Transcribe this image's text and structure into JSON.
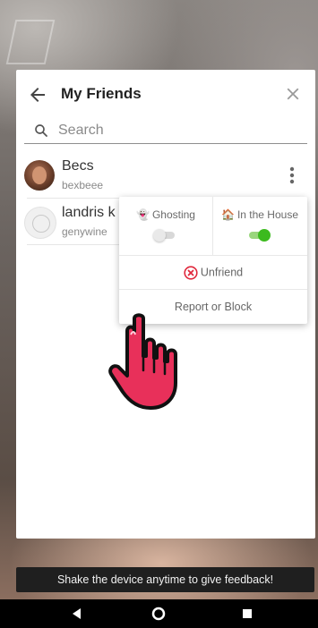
{
  "header": {
    "title": "My Friends",
    "back_icon": "arrow-left-icon",
    "close_icon": "close-icon"
  },
  "search": {
    "placeholder": "Search",
    "value": "",
    "icon": "search-icon"
  },
  "friends": [
    {
      "name": "Becs",
      "username": "bexbeee",
      "avatar": "photo"
    },
    {
      "name": "landris k",
      "username": "genywine",
      "avatar": "ghost-placeholder"
    }
  ],
  "context_menu": {
    "ghosting": {
      "emoji": "👻",
      "label": "Ghosting",
      "enabled": false
    },
    "in_the_house": {
      "emoji": "🏠",
      "label": "In the House",
      "enabled": true
    },
    "unfriend_label": "Unfriend",
    "report_label": "Report or Block"
  },
  "feedback_banner": "Shake the device anytime to give feedback!",
  "colors": {
    "toggle_on": "#3cba1e",
    "unfriend_red": "#e0283c",
    "pointer_hand": "#e8305a"
  },
  "android_nav": [
    "back-triangle-icon",
    "home-circle-icon",
    "recents-square-icon"
  ]
}
